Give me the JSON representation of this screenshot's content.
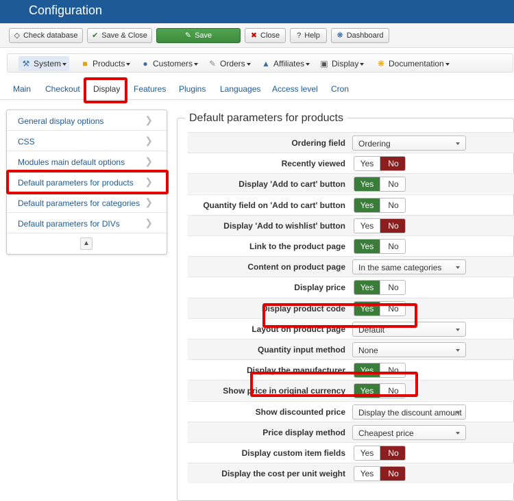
{
  "app": {
    "title": "Configuration"
  },
  "toolbar": {
    "check_database": "Check database",
    "save_close": "Save & Close",
    "save": "Save",
    "close": "Close",
    "help": "Help",
    "dashboard": "Dashboard"
  },
  "menu": {
    "system": "System",
    "products": "Products",
    "customers": "Customers",
    "orders": "Orders",
    "affiliates": "Affiliates",
    "display": "Display",
    "documentation": "Documentation"
  },
  "tabs": [
    "Main",
    "Checkout",
    "Display",
    "Features",
    "Plugins",
    "Languages",
    "Access level",
    "Cron"
  ],
  "sidenav": [
    "General display options",
    "CSS",
    "Modules main default options",
    "Default parameters for products",
    "Default parameters for categories",
    "Default parameters for DIVs"
  ],
  "panel": {
    "legend": "Default parameters for products"
  },
  "toggle": {
    "yes": "Yes",
    "no": "No"
  },
  "params": [
    {
      "label": "Ordering field",
      "type": "select",
      "value": "Ordering"
    },
    {
      "label": "Recently viewed",
      "type": "yesno",
      "value": "No"
    },
    {
      "label": "Display 'Add to cart' button",
      "type": "yesno",
      "value": "Yes"
    },
    {
      "label": "Quantity field on 'Add to cart' button",
      "type": "yesno",
      "value": "Yes"
    },
    {
      "label": "Display 'Add to wishlist' button",
      "type": "yesno",
      "value": "No"
    },
    {
      "label": "Link to the product page",
      "type": "yesno",
      "value": "Yes"
    },
    {
      "label": "Content on product page",
      "type": "select",
      "value": "In the same categories"
    },
    {
      "label": "Display price",
      "type": "yesno",
      "value": "Yes"
    },
    {
      "label": "Display product code",
      "type": "yesno",
      "value": "Yes"
    },
    {
      "label": "Layout on product page",
      "type": "select",
      "value": "Default"
    },
    {
      "label": "Quantity input method",
      "type": "select",
      "value": "None"
    },
    {
      "label": "Display the manufacturer",
      "type": "yesno",
      "value": "Yes"
    },
    {
      "label": "Show price in original currency",
      "type": "yesno",
      "value": "Yes"
    },
    {
      "label": "Show discounted price",
      "type": "select",
      "value": "Display the discount amount"
    },
    {
      "label": "Price display method",
      "type": "select",
      "value": "Cheapest price"
    },
    {
      "label": "Display custom item fields",
      "type": "yesno",
      "value": "No"
    },
    {
      "label": "Display the cost per unit weight",
      "type": "yesno",
      "value": "No"
    }
  ],
  "colors": {
    "titlebar": "#1e5a98",
    "save": "#4a9a4a",
    "yes_on": "#3a7d3a",
    "no_on": "#8b1e1e",
    "highlight": "#e00000",
    "link": "#1e5a98"
  }
}
